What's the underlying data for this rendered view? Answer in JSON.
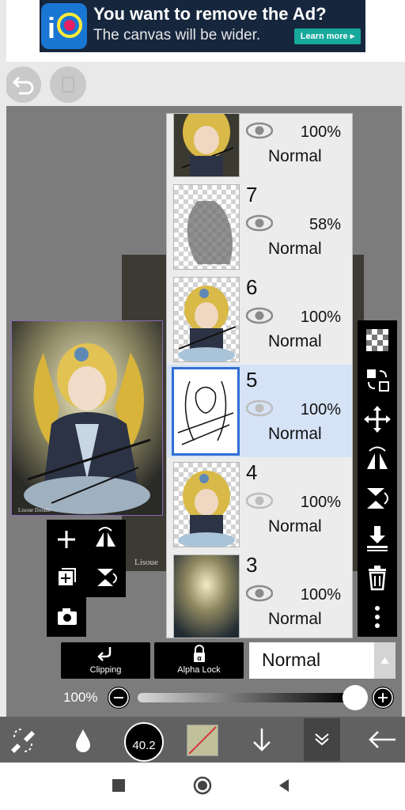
{
  "ad": {
    "title": "You want to remove the Ad?",
    "subtitle": "The canvas will be wider.",
    "button": "Learn more ▸"
  },
  "icons": [
    "undo-icon",
    "menu-icon",
    "eye-icon",
    "checker-icon",
    "transform-icon",
    "move-icon",
    "flip-h-icon",
    "flip-v-icon",
    "merge-down-icon",
    "trash-icon",
    "more-icon",
    "plus-icon",
    "add-layer-icon",
    "camera-icon",
    "brush-icon",
    "drop-icon",
    "arrow-down-icon",
    "chevron-down-icon",
    "back-arrow-icon"
  ],
  "layers": [
    {
      "number": "",
      "opacity": "100%",
      "mode": "Normal",
      "visible": true,
      "selected": false
    },
    {
      "number": "7",
      "opacity": "58%",
      "mode": "Normal",
      "visible": true,
      "selected": false
    },
    {
      "number": "6",
      "opacity": "100%",
      "mode": "Normal",
      "visible": true,
      "selected": false
    },
    {
      "number": "5",
      "opacity": "100%",
      "mode": "Normal",
      "visible": true,
      "selected": true
    },
    {
      "number": "4",
      "opacity": "100%",
      "mode": "Normal",
      "visible": true,
      "selected": false
    },
    {
      "number": "3",
      "opacity": "100%",
      "mode": "Normal",
      "visible": true,
      "selected": false
    }
  ],
  "preview": {
    "signature": "Lisoue Doodle",
    "behind_text": "Lisoue"
  },
  "controls": {
    "clipping_label": "Clipping",
    "alpha_lock_label": "Alpha Lock",
    "blend_mode": "Normal",
    "opacity_value": "100%",
    "brush_size": "40.2"
  },
  "colors": {
    "accent": "#2f6fd4",
    "selected_layer": "#d6e3f7",
    "ad_background": "#16263d",
    "learn_more": "#17a99b"
  }
}
